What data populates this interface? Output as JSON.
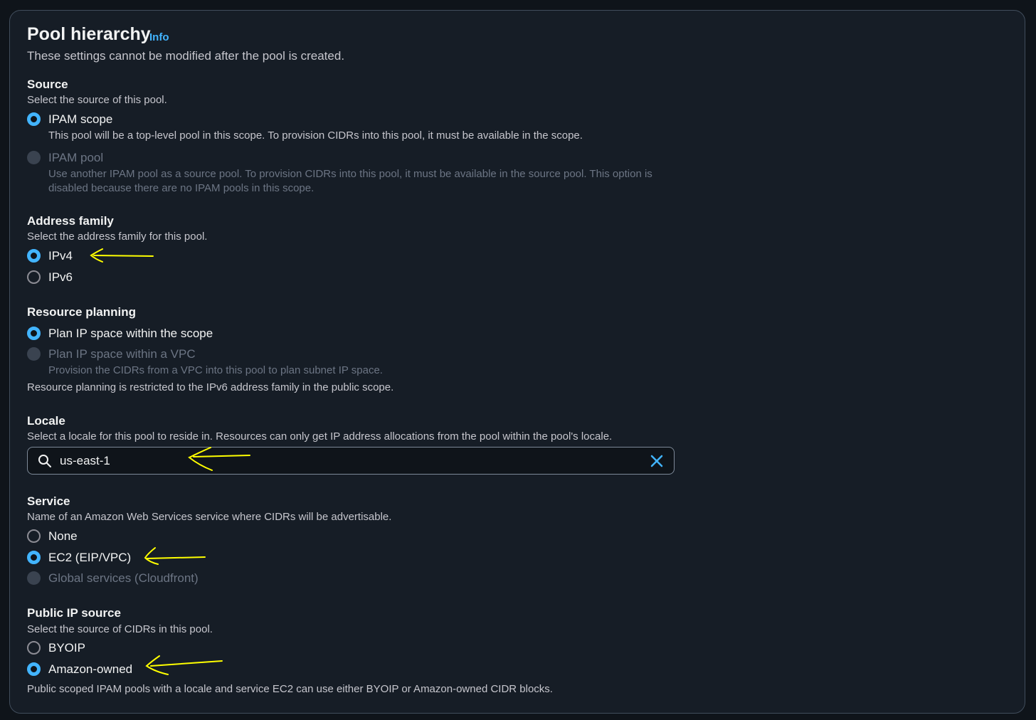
{
  "header": {
    "title": "Pool hierarchy",
    "info_link": "Info",
    "subtitle": "These settings cannot be modified after the pool is created."
  },
  "source": {
    "title": "Source",
    "description": "Select the source of this pool.",
    "options": [
      {
        "label": "IPAM scope",
        "description": "This pool will be a top-level pool in this scope. To provision CIDRs into this pool, it must be available in the scope.",
        "state": "checked"
      },
      {
        "label": "IPAM pool",
        "description": "Use another IPAM pool as a source pool. To provision CIDRs into this pool, it must be available in the source pool. This option is disabled because there are no IPAM pools in this scope.",
        "state": "disabled"
      }
    ]
  },
  "address_family": {
    "title": "Address family",
    "description": "Select the address family for this pool.",
    "options": [
      {
        "label": "IPv4",
        "state": "checked"
      },
      {
        "label": "IPv6",
        "state": "unchecked"
      }
    ]
  },
  "resource_planning": {
    "title": "Resource planning",
    "options": [
      {
        "label": "Plan IP space within the scope",
        "state": "checked"
      },
      {
        "label": "Plan IP space within a VPC",
        "description": "Provision the CIDRs from a VPC into this pool to plan subnet IP space.",
        "state": "disabled"
      }
    ],
    "note": "Resource planning is restricted to the IPv6 address family in the public scope."
  },
  "locale": {
    "title": "Locale",
    "description": "Select a locale for this pool to reside in. Resources can only get IP address allocations from the pool within the pool's locale.",
    "value": "us-east-1"
  },
  "service": {
    "title": "Service",
    "description": "Name of an Amazon Web Services service where CIDRs will be advertisable.",
    "options": [
      {
        "label": "None",
        "state": "unchecked"
      },
      {
        "label": "EC2 (EIP/VPC)",
        "state": "checked"
      },
      {
        "label": "Global services (Cloudfront)",
        "state": "disabled"
      }
    ]
  },
  "public_ip_source": {
    "title": "Public IP source",
    "description": "Select the source of CIDRs in this pool.",
    "options": [
      {
        "label": "BYOIP",
        "state": "unchecked"
      },
      {
        "label": "Amazon-owned",
        "state": "checked"
      }
    ],
    "note": "Public scoped IPAM pools with a locale and service EC2 can use either BYOIP or Amazon-owned CIDR blocks."
  },
  "colors": {
    "accent": "#42b4ff",
    "annotation": "#ffff00",
    "background": "#161d26"
  },
  "icons": {
    "search": "search-icon",
    "clear": "close-icon"
  }
}
